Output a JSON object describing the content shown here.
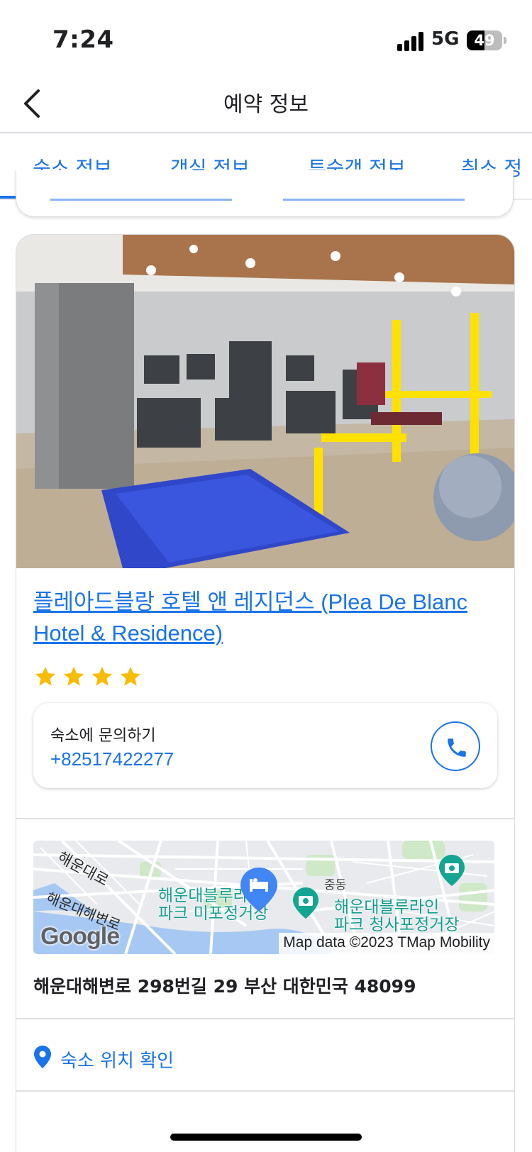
{
  "status_bar": {
    "time": "7:24",
    "network": "5G",
    "battery": "49",
    "battery_percent": 49
  },
  "header": {
    "title": "예약 정보",
    "back_icon": "chevron-left-icon"
  },
  "tabs": [
    {
      "label": "숙소 정보",
      "active": true
    },
    {
      "label": "객실 정보",
      "active": false
    },
    {
      "label": "투숙객 정보",
      "active": false
    },
    {
      "label": "취소 정",
      "active": false
    }
  ],
  "hotel": {
    "photo": "hotel-gym-photo",
    "name": "플레아드블랑 호텔 앤 레지던스 (Plea De Blanc Hotel & Residence)",
    "star_rating": 4,
    "contact": {
      "label": "숙소에 문의하기",
      "phone": "+82517422277",
      "call_icon": "phone-icon"
    },
    "map": {
      "labels": {
        "road1": "해운대로",
        "road2": "해운대해변로",
        "district": "중동",
        "poi1_line1": "해운대블루라인",
        "poi1_line2": "파크 미포정거장",
        "poi2_line1": "해운대블루라인",
        "poi2_line2": "파크 청사포정거장"
      },
      "logo": "Google",
      "attribution": "Map data ©2023 TMap Mobility"
    },
    "address": "해운대해변로 298번길 29 부산 대한민국 48099",
    "location_link": {
      "label": "숙소 위치 확인",
      "icon": "location-pin-icon"
    }
  },
  "colors": {
    "accent": "#1a73e8",
    "star": "#f9bc04",
    "poi": "#129e8f"
  }
}
